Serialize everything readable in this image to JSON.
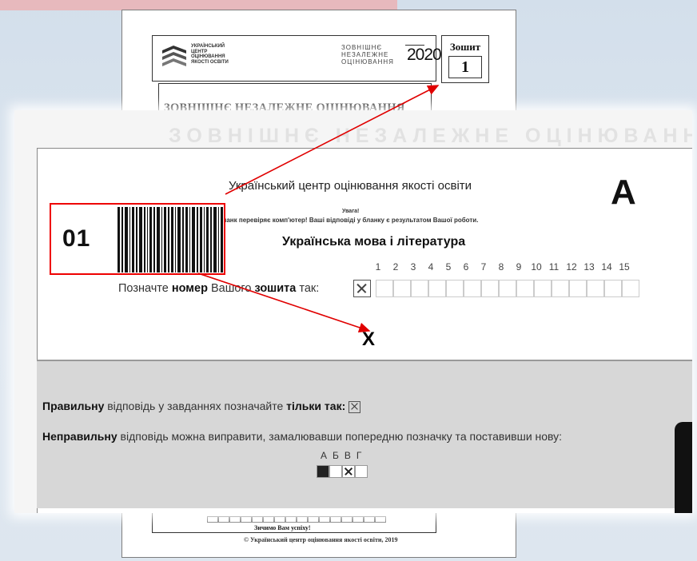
{
  "booklet": {
    "org_lines": [
      "УКРАЇНСЬКИЙ",
      "ЦЕНТР",
      "ОЦІНЮВАННЯ",
      "ЯКОСТІ ОСВІТИ"
    ],
    "zno_lines": [
      "ЗОВНІШНЄ",
      "НЕЗАЛЕЖНЕ",
      "ОЦІНЮВАННЯ"
    ],
    "zno_year": "2020",
    "zoshyt_label": "Зошит",
    "zoshyt_number": "1",
    "title": "ЗОВНІШНЄ НЕЗАЛЕЖНЕ ОЦІНЮВАННЯ",
    "good_luck": "Зичимо Вам успіху!",
    "copyright": "© Український центр оцінювання якості освіти, 2019"
  },
  "answer_sheet": {
    "ghost_title": "ЗОВНІШНЄ НЕЗАЛЕЖНЕ ОЦІНЮВАННЯ",
    "centre_name": "Український центр оцінювання якості освіти",
    "letter": "A",
    "attention": "Увага!",
    "note": "Цей бланк перевіряє комп'ютер! Ваші відповіді у бланку є результатом Вашої роботи.",
    "subject": "Українська мова і література",
    "booklet_code": "01",
    "numbers": [
      "1",
      "2",
      "3",
      "4",
      "5",
      "6",
      "7",
      "8",
      "9",
      "10",
      "11",
      "12",
      "13",
      "14",
      "15"
    ],
    "mark_label_pre": "Позначте ",
    "mark_label_bold1": "номер",
    "mark_label_mid": " Вашого ",
    "mark_label_bold2": "зошита",
    "mark_label_post": " так:",
    "big_x": "X",
    "rule1_bold": "Правильну",
    "rule1_text": " відповідь у завданнях позначайте ",
    "rule1_bold2": "тільки так:",
    "rule2_bold": "Неправильну",
    "rule2_text": " відповідь можна виправити, замалювавши попередню позначку та поставивши нову:",
    "options": "АБВГ"
  },
  "colors": {
    "arrow": "#e00000",
    "highlight_box": "#e00000"
  }
}
